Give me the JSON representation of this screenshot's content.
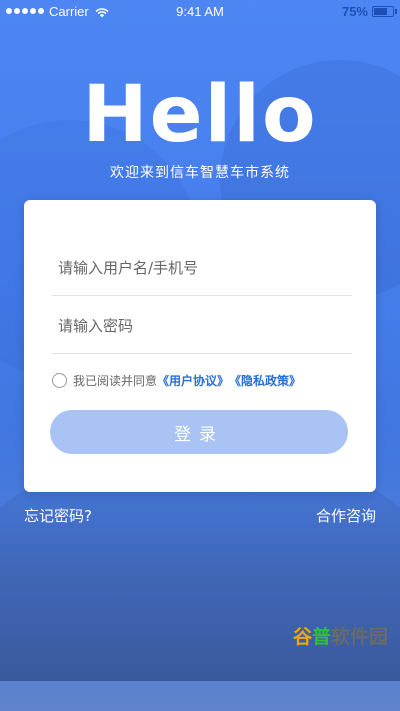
{
  "status_bar": {
    "carrier": "Carrier",
    "time": "9:41 AM",
    "battery_percent": "75%",
    "battery_level": 0.75
  },
  "hero": {
    "title": "Hello",
    "subtitle": "欢迎来到信车智慧车市系统"
  },
  "login_form": {
    "username_placeholder": "请输入用户名/手机号",
    "password_placeholder": "请输入密码",
    "agree_text": "我已阅读并同意",
    "user_agreement_link": "《用户协议》",
    "privacy_policy_link": "《隐私政策》",
    "login_button": "登录"
  },
  "footer_links": {
    "forgot_password": "忘记密码?",
    "cooperation": "合作咨询"
  },
  "watermark": {
    "part1": "谷",
    "part2": "普",
    "part3": "软件园"
  },
  "colors": {
    "primary": "#4a7fe6",
    "button_disabled": "#a9c4f4",
    "link": "#2a6fd6"
  }
}
